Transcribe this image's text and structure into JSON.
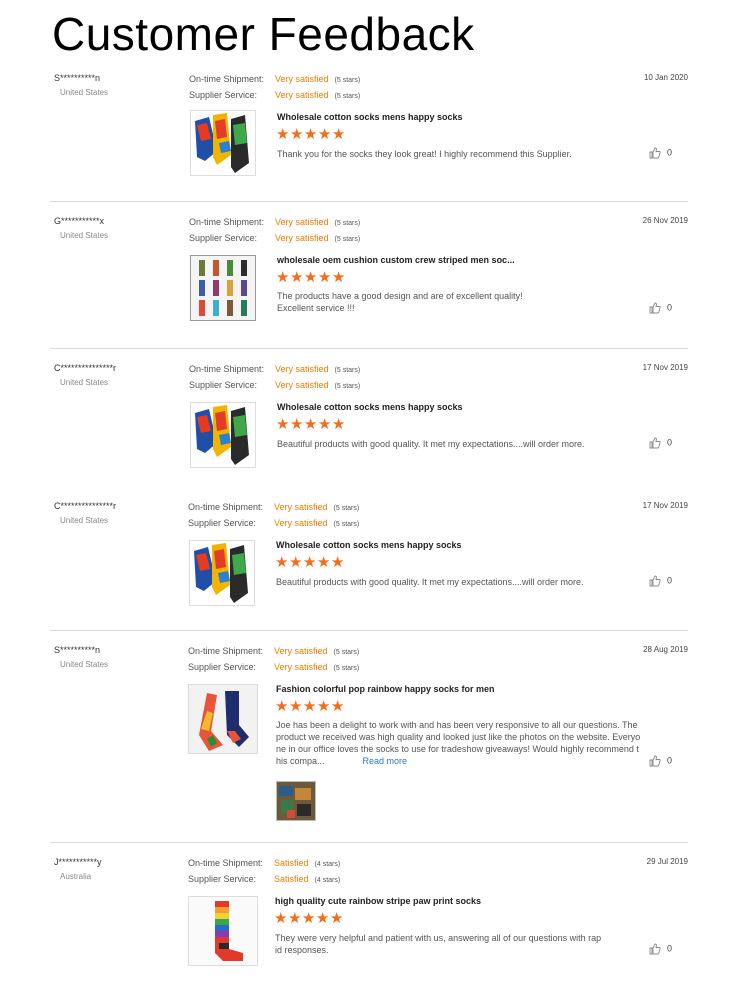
{
  "page": {
    "title": "Customer Feedback"
  },
  "labels": {
    "shipment": "On-time Shipment:",
    "service": "Supplier Service:",
    "read_more": "Read more"
  },
  "colors": {
    "accent": "#f07c00",
    "star": "#f36d1b",
    "link": "#2a7ac0",
    "divider": "#dcdcdc"
  },
  "icons": {
    "like": "thumbs-up-icon",
    "star": "star-icon"
  },
  "reviews": [
    {
      "buyer": "S**********n",
      "country": "United States",
      "date": "10 Jan 2020",
      "shipment": "Very satisfied",
      "shipment_stars": "(5 stars)",
      "service": "Very satisfied",
      "service_stars": "(5 stars)",
      "product": "Wholesale cotton socks mens happy socks",
      "stars": 5,
      "text": "Thank you for the socks they look great! I highly recommend this Supplier.",
      "likes": "0"
    },
    {
      "buyer": "G***********x",
      "country": "United States",
      "date": "26 Nov 2019",
      "shipment": "Very satisfied",
      "shipment_stars": "(5 stars)",
      "service": "Very satisfied",
      "service_stars": "(5 stars)",
      "product": "wholesale oem cushion custom crew striped men soc...",
      "stars": 5,
      "text_line1": "The products have a good design and are of excellent quality!",
      "text_line2": "Excellent service !!!",
      "likes": "0"
    },
    {
      "buyer": "C***************r",
      "country": "United States",
      "date": "17 Nov 2019",
      "shipment": "Very satisfied",
      "shipment_stars": "(5 stars)",
      "service": "Very satisfied",
      "service_stars": "(5 stars)",
      "product": "Wholesale cotton socks mens happy socks",
      "stars": 5,
      "text": "Beautiful products with good quality. It met my expectations....will order more.",
      "likes": "0"
    },
    {
      "buyer": "C***************r",
      "country": "United States",
      "date": "17 Nov 2019",
      "shipment": "Very satisfied",
      "shipment_stars": "(5 stars)",
      "service": "Very satisfied",
      "service_stars": "(5 stars)",
      "product": "Wholesale cotton socks mens happy socks",
      "stars": 5,
      "text": "Beautiful products with good quality. It met my expectations....will order more.",
      "likes": "0"
    },
    {
      "buyer": "S**********n",
      "country": "United States",
      "date": "28 Aug 2019",
      "shipment": "Very satisfied",
      "shipment_stars": "(5 stars)",
      "service": "Very satisfied",
      "service_stars": "(5 stars)",
      "product": "Fashion colorful pop rainbow happy socks for men",
      "stars": 5,
      "text_line1": "Joe has been a delight to work with and has been very responsive to all our questions. The",
      "text_line2": "product we received was high quality and looked just like the photos on the website. Everyo",
      "text_line3": "ne in our office loves the socks to use for tradeshow giveaways! Would highly recommend t",
      "text_line4": "his compa...",
      "likes": "0"
    },
    {
      "buyer": "J***********y",
      "country": "Australia",
      "date": "29 Jul 2019",
      "shipment": "Satisfied",
      "shipment_stars": "(4 stars)",
      "service": "Satisfied",
      "service_stars": "(4 stars)",
      "product": "high quality cute rainbow stripe paw print socks",
      "stars": 5,
      "text_line1": "They were very helpful and patient with us, answering all of our questions with rap",
      "text_line2": "id responses.",
      "likes": "0"
    }
  ]
}
